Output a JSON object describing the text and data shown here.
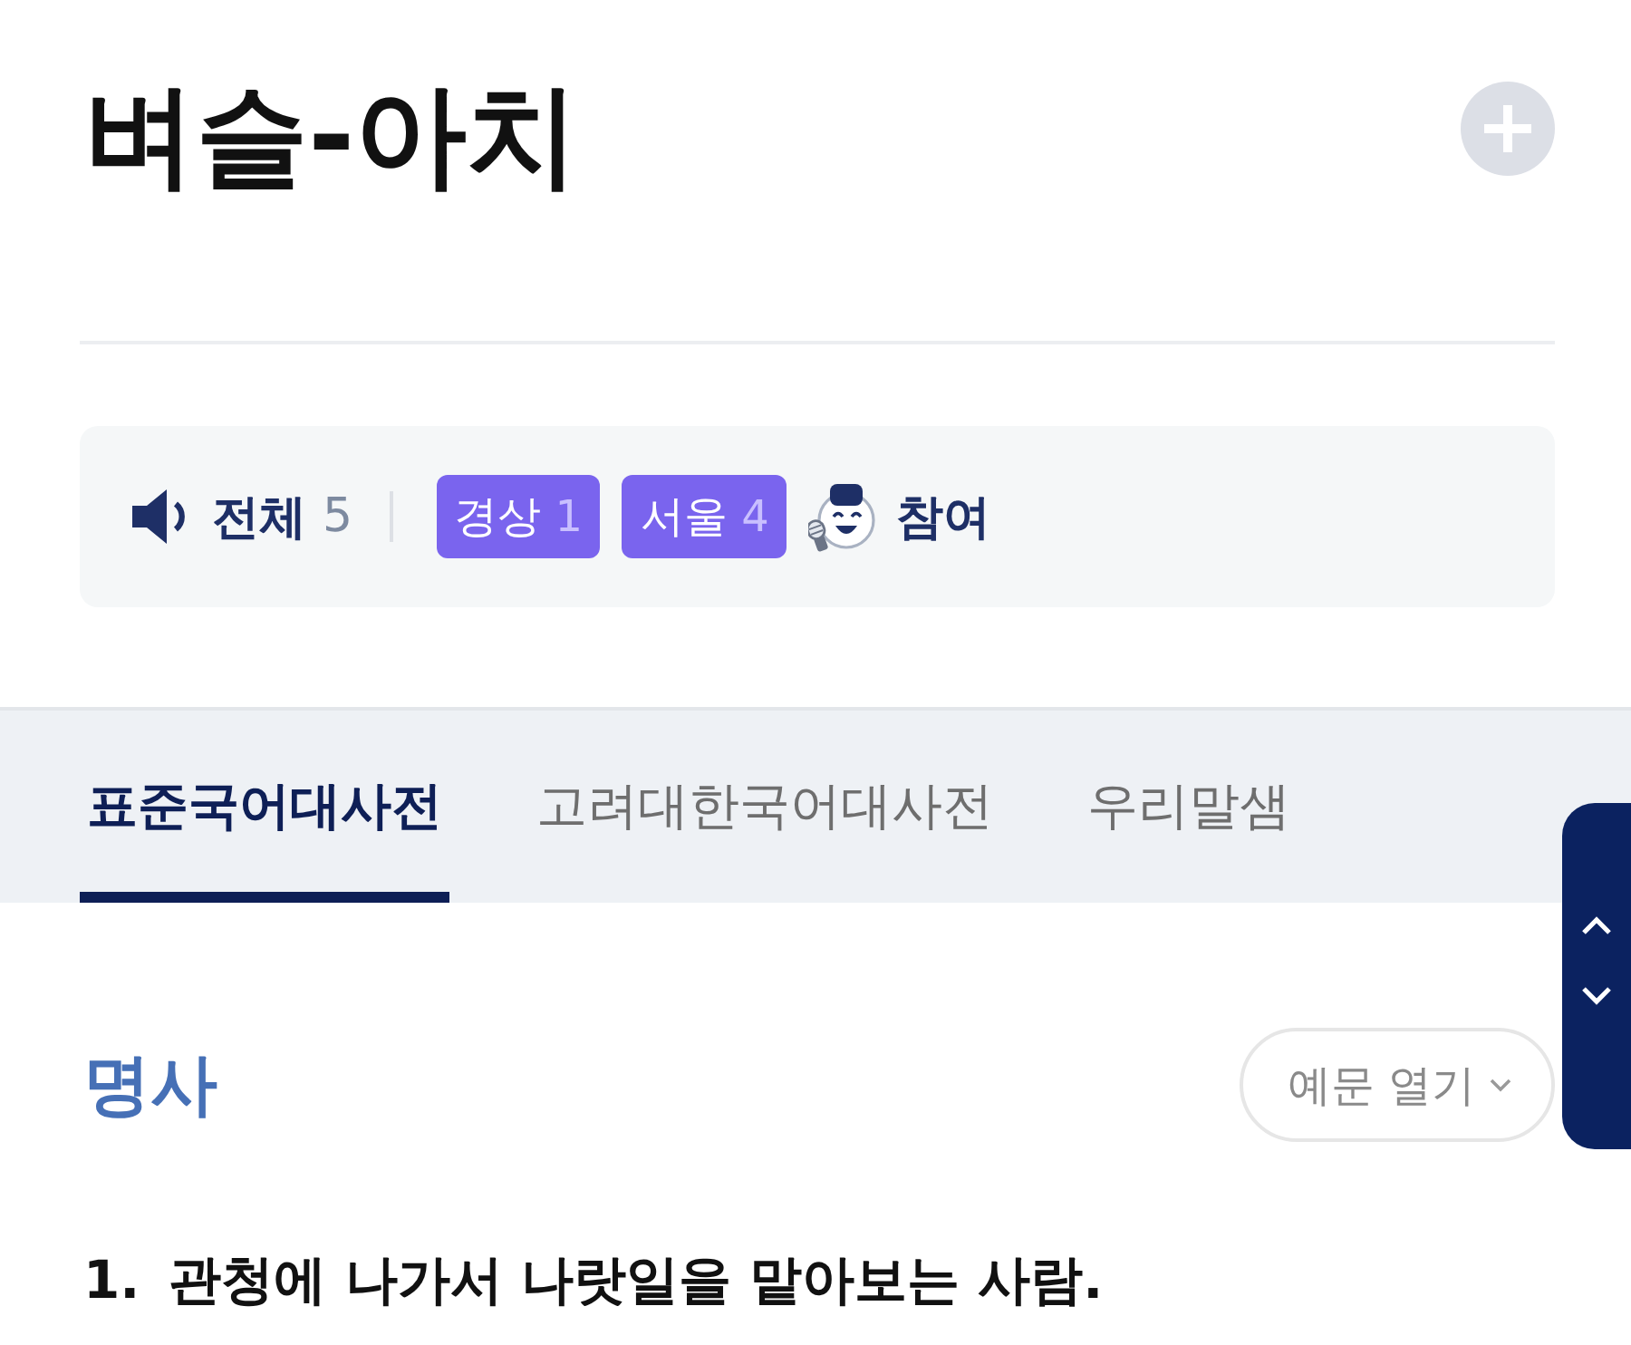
{
  "header": {
    "title": "벼슬-아치"
  },
  "pronunciation": {
    "total_label": "전체",
    "total_count": "5",
    "dialects": [
      {
        "label": "경상",
        "count": "1"
      },
      {
        "label": "서울",
        "count": "4"
      }
    ],
    "participate_label": "참여"
  },
  "tabs": [
    {
      "label": "표준국어대사전",
      "selected": true
    },
    {
      "label": "고려대한국어대사전",
      "selected": false
    },
    {
      "label": "우리말샘",
      "selected": false
    }
  ],
  "entry": {
    "part_of_speech": "명사",
    "examples_toggle": "예문 열기",
    "definitions": [
      {
        "number": "1.",
        "text": "관청에 나가서 나랏일을 맡아보는 사람."
      }
    ]
  }
}
